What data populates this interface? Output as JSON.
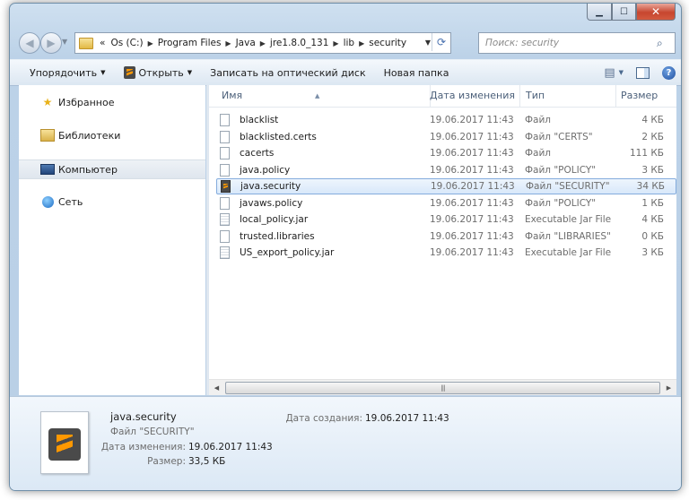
{
  "address": {
    "crumbs": [
      "Os (C:)",
      "Program Files",
      "Java",
      "jre1.8.0_131",
      "lib",
      "security"
    ],
    "overflow": "«"
  },
  "search": {
    "placeholder": "Поиск: security"
  },
  "toolbar": {
    "organize": "Упорядочить",
    "open": "Открыть",
    "burn": "Записать на оптический диск",
    "new_folder": "Новая папка"
  },
  "nav": {
    "favorites": "Избранное",
    "libraries": "Библиотеки",
    "computer": "Компьютер",
    "network": "Сеть"
  },
  "columns": {
    "name": "Имя",
    "date": "Дата изменения",
    "type": "Тип",
    "size": "Размер"
  },
  "files": [
    {
      "name": "blacklist",
      "date": "19.06.2017 11:43",
      "type": "Файл",
      "size": "4 КБ",
      "icon": "file-icon"
    },
    {
      "name": "blacklisted.certs",
      "date": "19.06.2017 11:43",
      "type": "Файл \"CERTS\"",
      "size": "2 КБ",
      "icon": "file-icon"
    },
    {
      "name": "cacerts",
      "date": "19.06.2017 11:43",
      "type": "Файл",
      "size": "111 КБ",
      "icon": "file-icon"
    },
    {
      "name": "java.policy",
      "date": "19.06.2017 11:43",
      "type": "Файл \"POLICY\"",
      "size": "3 КБ",
      "icon": "file-icon"
    },
    {
      "name": "java.security",
      "date": "19.06.2017 11:43",
      "type": "Файл \"SECURITY\"",
      "size": "34 КБ",
      "icon": "sublime-file-icon"
    },
    {
      "name": "javaws.policy",
      "date": "19.06.2017 11:43",
      "type": "Файл \"POLICY\"",
      "size": "1 КБ",
      "icon": "file-icon"
    },
    {
      "name": "local_policy.jar",
      "date": "19.06.2017 11:43",
      "type": "Executable Jar File",
      "size": "4 КБ",
      "icon": "jar-file-icon"
    },
    {
      "name": "trusted.libraries",
      "date": "19.06.2017 11:43",
      "type": "Файл \"LIBRARIES\"",
      "size": "0 КБ",
      "icon": "file-icon"
    },
    {
      "name": "US_export_policy.jar",
      "date": "19.06.2017 11:43",
      "type": "Executable Jar File",
      "size": "3 КБ",
      "icon": "jar-file-icon"
    }
  ],
  "selected_index": 4,
  "details": {
    "name": "java.security",
    "type": "Файл \"SECURITY\"",
    "modified_label": "Дата изменения:",
    "modified_value": "19.06.2017 11:43",
    "size_label": "Размер:",
    "size_value": "33,5 КБ",
    "created_label": "Дата создания:",
    "created_value": "19.06.2017 11:43"
  }
}
